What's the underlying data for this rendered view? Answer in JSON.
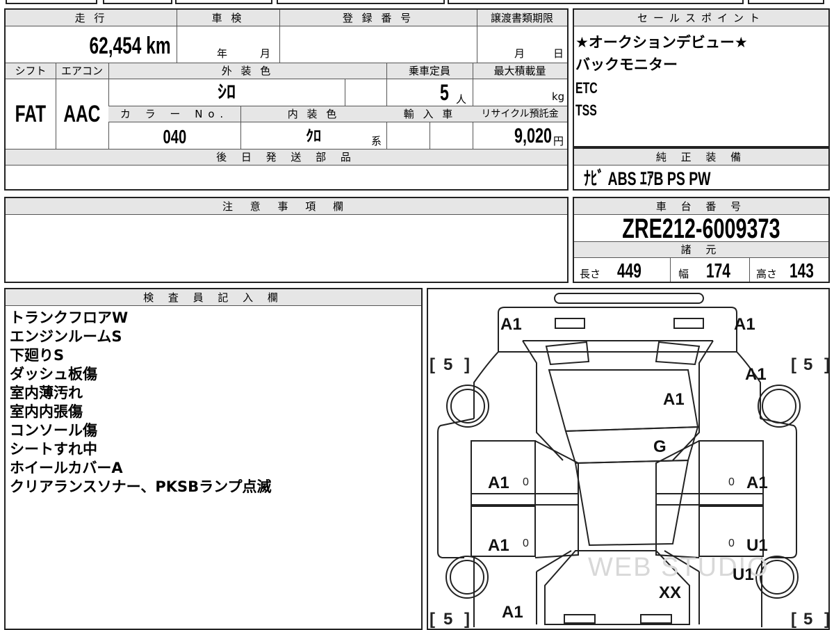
{
  "main": {
    "mileage_label": "走 行",
    "mileage_value": "62,454 km",
    "shaken_label": "車 検",
    "shaken_year": "年",
    "shaken_month": "月",
    "reg_no_label": "登 録 番 号",
    "transfer_label": "譲渡書類期限",
    "transfer_month": "月",
    "transfer_day": "日",
    "shift_label": "シフト",
    "aircon_label": "エアコン",
    "ext_color_label": "外 装 色",
    "capacity_label": "乗車定員",
    "max_load_label": "最大積載量",
    "shift_value": "FAT",
    "aircon_value": "AAC",
    "ext_color_value": "ｼﾛ",
    "capacity_value": "5",
    "capacity_unit": "人",
    "max_load_unit": "kg",
    "color_no_label": "カ ラ ー No.",
    "int_color_label": "内 装 色",
    "import_label": "輸 入 車",
    "recycle_label": "リサイクル預託金",
    "color_no_value": "040",
    "int_color_value": "ｸﾛ",
    "int_color_suffix": "系",
    "recycle_value": "9,020",
    "recycle_unit": "円",
    "later_parts_label": "後 日 発 送 部 品"
  },
  "sales": {
    "header": "セールスポイント",
    "lines": [
      "★オークションデビュー★",
      "バックモニター",
      "ETC",
      "TSS"
    ]
  },
  "equipment": {
    "header": "純 正 装 備",
    "value": "ﾅﾋﾞ ABS ｴｱB PS PW"
  },
  "notes": {
    "header": "注 意 事 項 欄"
  },
  "chassis": {
    "header": "車 台 番 号",
    "value": "ZRE212-6009373"
  },
  "specs": {
    "header": "諸 元",
    "length_label": "長さ",
    "length_value": "449",
    "width_label": "幅",
    "width_value": "174",
    "height_label": "高さ",
    "height_value": "143"
  },
  "inspector": {
    "header": "検 査 員 記 入 欄",
    "lines": [
      "トランクフロアW",
      "エンジンルームS",
      "下廻りS",
      "ダッシュ板傷",
      "室内薄汚れ",
      "室内内張傷",
      "コンソール傷",
      "シートすれ中",
      "ホイールカバーA",
      "クリアランスソナー、PKSBランプ点滅"
    ]
  },
  "diagram": {
    "watermark": "WEB STUDIO",
    "marks": {
      "rear_left": "A1",
      "rear_right": "A1",
      "trunk": "A1",
      "rear_quarter_right": "A1",
      "roof": "G",
      "rear_door_left": "A1",
      "rear_door_right": "A1",
      "front_door_left": "A1",
      "front_door_right": "U1",
      "front_fender_right": "U1",
      "hood": "XX",
      "front_fender_left": "A1"
    },
    "tires": {
      "rear_left": "5",
      "rear_right": "5",
      "front_left": "5",
      "front_right": "5"
    },
    "door_small": {
      "rl": "0",
      "rr": "0",
      "fl": "0",
      "fr": "0"
    }
  }
}
